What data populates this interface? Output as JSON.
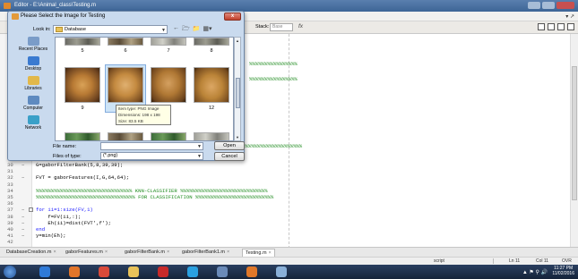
{
  "editor": {
    "title": "Editor - E:\\Animal_class\\Testing.m",
    "stack_label": "Stack:",
    "stack_value": "Base",
    "fx": "fx"
  },
  "dialog": {
    "title": "Please Select the Image for Testing",
    "close": "x",
    "look_in_label": "Look in:",
    "look_in_value": "Database",
    "places": [
      {
        "label": "Recent Places",
        "icon": "recent-places-icon",
        "color": "#7a9cc8"
      },
      {
        "label": "Desktop",
        "icon": "desktop-icon",
        "color": "#3a7ad0"
      },
      {
        "label": "Libraries",
        "icon": "libraries-icon",
        "color": "#e2b84a"
      },
      {
        "label": "Computer",
        "icon": "computer-icon",
        "color": "#5e8ac0"
      },
      {
        "label": "Network",
        "icon": "network-icon",
        "color": "#3aa0c8"
      }
    ],
    "top_row_labels": [
      "5",
      "6",
      "7",
      "8"
    ],
    "middle_row_labels": [
      "9",
      "10",
      "11",
      "12"
    ],
    "selected_index": "10",
    "tooltip": {
      "type": "Item type: PNG Image",
      "dimensions": "Dimensions: 198 x 198",
      "size": "Size: 83.5 KB"
    },
    "file_name_label": "File name:",
    "file_name_value": "",
    "files_of_type_label": "Files of type:",
    "files_of_type_value": "(*.png)",
    "open_button": "Open",
    "cancel_button": "Cancel"
  },
  "code": {
    "lines": [
      {
        "n": "30",
        "dash": "−",
        "code": "G=gaborFilterBank(5,8,39,39);",
        "style": ""
      },
      {
        "n": "31",
        "dash": "",
        "code": "",
        "style": ""
      },
      {
        "n": "32",
        "dash": "−",
        "code": "FVT = gaborFeatures(I,G,64,64);",
        "style": ""
      },
      {
        "n": "33",
        "dash": "",
        "code": "",
        "style": ""
      },
      {
        "n": "34",
        "dash": "",
        "code": "%%%%%%%%%%%%%%%%%%%%%%%%%%%%%%%% KNN-CLASSIFIER %%%%%%%%%%%%%%%%%%%%%%%%%%%%%",
        "style": "green"
      },
      {
        "n": "35",
        "dash": "",
        "code": "%%%%%%%%%%%%%%%%%%%%%%%%%%%%%%%%% FOR CLASSIFICATION %%%%%%%%%%%%%%%%%%%%%%%%%%",
        "style": "green"
      },
      {
        "n": "36",
        "dash": "",
        "code": "",
        "style": ""
      },
      {
        "n": "37",
        "dash": "−",
        "code": "for ii=1:size(FV,1)",
        "style": "for"
      },
      {
        "n": "38",
        "dash": "−",
        "code": "    f=FV(ii,:);",
        "style": ""
      },
      {
        "n": "39",
        "dash": "−",
        "code": "    Eh(ii)=dist(FVT',f');",
        "style": ""
      },
      {
        "n": "40",
        "dash": "−",
        "code": "end",
        "style": "end"
      },
      {
        "n": "41",
        "dash": "−",
        "code": "y=min(Eh);",
        "style": ""
      },
      {
        "n": "42",
        "dash": "",
        "code": "",
        "style": ""
      }
    ],
    "fragment_a": "%%%%%%%%%%%%%%%%",
    "fragment_b": "%%%%%%%%%%%%%%%%",
    "fragment_c": "%%%%%%%%%%%%%%%%%%%%"
  },
  "tabs": [
    {
      "label": "DatabaseCreation.m",
      "active": false
    },
    {
      "label": "gaborFeatures.m",
      "active": false
    },
    {
      "label": "gaborFilterBank.m",
      "active": false
    },
    {
      "label": "gaborFilterBank1.m",
      "active": false
    },
    {
      "label": "Testing.m",
      "active": true
    }
  ],
  "status": {
    "mode": "script",
    "ln": "Ln  11",
    "col": "Col  11",
    "ovr": "OVR"
  },
  "taskbar": {
    "time": "11:27 PM",
    "date": "11/02/2016",
    "apps": [
      {
        "name": "ie-icon",
        "color": "#2f7ad8"
      },
      {
        "name": "firefox-icon",
        "color": "#e2752a"
      },
      {
        "name": "chrome-icon",
        "color": "#d94a3a"
      },
      {
        "name": "explorer-icon",
        "color": "#e8c25a"
      },
      {
        "name": "opera-icon",
        "color": "#c82a2a"
      },
      {
        "name": "skype-icon",
        "color": "#2aa0e0"
      },
      {
        "name": "windows-explorer-icon",
        "color": "#6a8ab8"
      },
      {
        "name": "matlab-icon",
        "color": "#e0782a"
      },
      {
        "name": "paint-icon",
        "color": "#8ab0d8"
      }
    ]
  }
}
